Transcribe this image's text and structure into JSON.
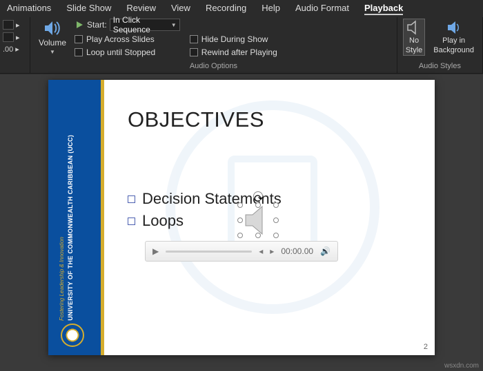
{
  "tabs": {
    "animations": "Animations",
    "slideshow": "Slide Show",
    "review": "Review",
    "view": "View",
    "recording": "Recording",
    "help": "Help",
    "audioformat": "Audio Format",
    "playback": "Playback"
  },
  "ribbon": {
    "left_crop_value": ".00",
    "volume_label": "Volume",
    "start_label": "Start:",
    "start_value": "In Click Sequence",
    "play_across": "Play Across Slides",
    "loop_stopped": "Loop until Stopped",
    "hide_show": "Hide During Show",
    "rewind": "Rewind after Playing",
    "group_audio_options": "Audio Options",
    "no_style_l1": "No",
    "no_style_l2": "Style",
    "play_bg_l1": "Play in",
    "play_bg_l2": "Background",
    "group_audio_styles": "Audio Styles"
  },
  "slide": {
    "title": "OBJECTIVES",
    "bullet1": "Decision Statements",
    "bullet2": "Loops",
    "time": "00:00.00",
    "side_line1": "UNIVERSITY OF THE",
    "side_line2": "COMMONWEALTH",
    "side_line3": "CARIBBEAN (UCC)",
    "side_sub": "Fostering Leadership & Innovation",
    "page": "2"
  },
  "watermark": "wsxdn.com",
  "icons": {
    "volume": "volume-icon",
    "speaker": "speaker-icon",
    "no_style": "no-style-icon",
    "play_bg": "play-background-icon",
    "play": "play-icon",
    "prev": "prev-frame-icon",
    "next": "next-frame-icon",
    "vol": "volume-small-icon",
    "caret": "chevron-down-icon"
  }
}
